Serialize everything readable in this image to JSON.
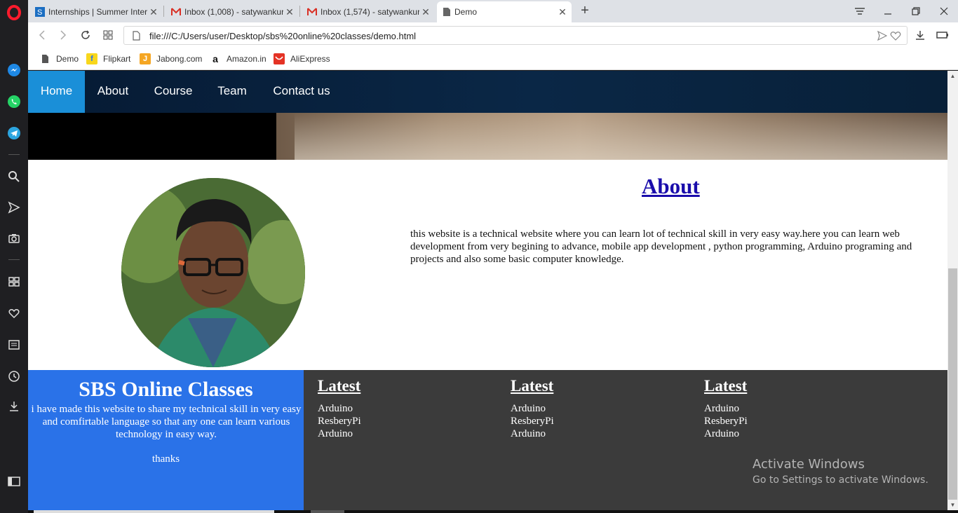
{
  "browser": {
    "tabs": [
      {
        "title": "Internships | Summer Inter",
        "icon": "internshala-icon",
        "color": "#1b6ec2"
      },
      {
        "title": "Inbox (1,008) - satywankur",
        "icon": "gmail-icon",
        "color": "#d93025"
      },
      {
        "title": "Inbox (1,574) - satywankur",
        "icon": "gmail-icon",
        "color": "#d93025"
      },
      {
        "title": "Demo",
        "icon": "page-icon",
        "color": "#555555"
      }
    ],
    "close_glyph": "✕",
    "new_tab_glyph": "+",
    "url": "file:///C:/Users/user/Desktop/sbs%20online%20classes/demo.html",
    "bookmarks": [
      {
        "label": "Demo",
        "icon": "page-icon"
      },
      {
        "label": "Flipkart",
        "icon": "flipkart-icon"
      },
      {
        "label": "Jabong.com",
        "icon": "jabong-icon"
      },
      {
        "label": "Amazon.in",
        "icon": "amazon-icon"
      },
      {
        "label": "AliExpress",
        "icon": "aliexpress-icon"
      }
    ],
    "bookmark_glyphs": {
      "flipkart": "f",
      "jabong": "J",
      "amazon": "a"
    }
  },
  "site": {
    "nav": [
      {
        "label": "Home",
        "active": true
      },
      {
        "label": "About",
        "active": false
      },
      {
        "label": "Course",
        "active": false
      },
      {
        "label": "Team",
        "active": false
      },
      {
        "label": "Contact us",
        "active": false
      }
    ],
    "about": {
      "title": "About",
      "text": "this website is a technical website where you can learn lot of technical skill in very easy way.here you can learn web development from very begining to advance, mobile app development , python programming, Arduino programing and projects and also some basic computer knowledge."
    },
    "footer": {
      "brand": "SBS Online Classes",
      "description": "i have made this website to share my technical skill in very easy and comfirtable language so that any one can learn various technology in easy way.",
      "thanks": "thanks",
      "columns": [
        {
          "heading": "Latest",
          "links": [
            "Arduino",
            "ResberyPi",
            "Arduino"
          ]
        },
        {
          "heading": "Latest",
          "links": [
            "Arduino",
            "ResberyPi",
            "Arduino"
          ]
        },
        {
          "heading": "Latest",
          "links": [
            "Arduino",
            "ResberyPi",
            "Arduino"
          ]
        }
      ]
    }
  },
  "watermark": {
    "line1": "Activate Windows",
    "line2": "Go to Settings to activate Windows."
  },
  "colors": {
    "nav_active": "#1a8fd8",
    "footer_blue": "#2a72e8",
    "footer_dark": "#3b3b3b",
    "link_blue": "#1a0dab"
  }
}
